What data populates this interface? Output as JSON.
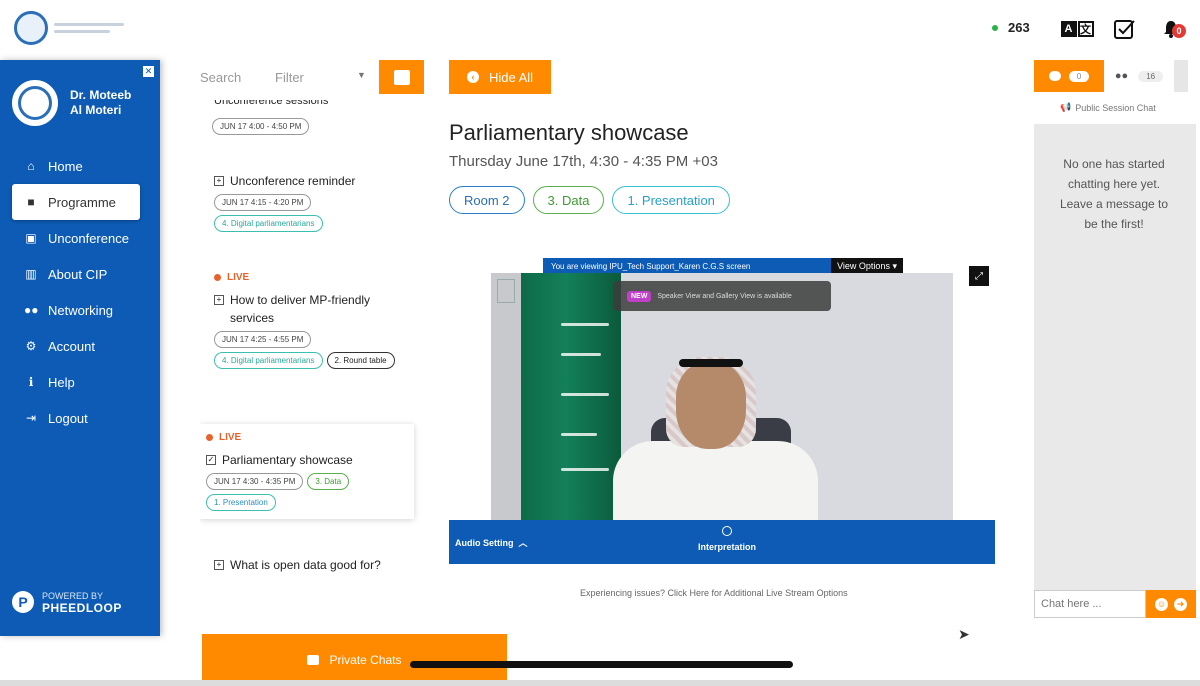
{
  "topbar": {
    "online_count": "263",
    "notification_count": "0"
  },
  "sidebar": {
    "profile_name": "Dr. Moteeb Al Moteri",
    "nav": [
      {
        "label": "Home",
        "icon": "home-icon"
      },
      {
        "label": "Programme",
        "icon": "video-icon",
        "active": true
      },
      {
        "label": "Unconference",
        "icon": "calendar-check-icon"
      },
      {
        "label": "About CIP",
        "icon": "building-icon"
      },
      {
        "label": "Networking",
        "icon": "people-icon"
      },
      {
        "label": "Account",
        "icon": "gear-icon"
      },
      {
        "label": "Help",
        "icon": "info-icon"
      },
      {
        "label": "Logout",
        "icon": "logout-icon"
      }
    ],
    "powered_by": "POWERED BY",
    "brand": "PHEEDLOOP"
  },
  "schedule": {
    "search_label": "Search",
    "filter_label": "Filter",
    "sessions": [
      {
        "title": "Unconference sessions",
        "time": "JUN 17 4:00 - 4:50 PM"
      },
      {
        "title": "Unconference reminder",
        "time": "JUN 17 4:15 - 4:20 PM",
        "tags": [
          "4. Digital parliamentarians"
        ]
      },
      {
        "live": "LIVE",
        "title": "How to deliver MP-friendly services",
        "time": "JUN 17 4:25 - 4:55 PM",
        "tags": [
          "4. Digital parliamentarians",
          "2. Round table"
        ]
      },
      {
        "live": "LIVE",
        "title": "Parliamentary showcase",
        "time": "JUN 17 4:30 - 4:35 PM",
        "tags": [
          "3. Data",
          "1. Presentation"
        ],
        "current": true
      },
      {
        "title": "What is open data good for?"
      }
    ],
    "private_chats_label": "Private Chats"
  },
  "main": {
    "hide_all_label": "Hide All",
    "title": "Parliamentary showcase",
    "datetime": "Thursday June 17th, 4:30 - 4:35 PM +03",
    "tags": [
      "Room 2",
      "3. Data",
      "1. Presentation"
    ],
    "viewing_text": "You are viewing IPU_Tech Support_Karen C.G.S screen",
    "view_options_label": "View Options",
    "new_badge": "NEW",
    "new_text": "Speaker View and Gallery View is available",
    "audio_setting_label": "Audio Setting",
    "interpretation_label": "Interpretation",
    "issues_text": "Experiencing issues? Click Here for Additional Live Stream Options"
  },
  "chat": {
    "chat_count": "0",
    "attendee_count": "16",
    "public_chat_label": "Public Session Chat",
    "empty_message": "No one has started chatting here yet. Leave a message to be the first!",
    "input_placeholder": "Chat here ..."
  },
  "colors": {
    "brand_blue": "#0d5bb5",
    "accent_orange": "#ff8a00",
    "live_red": "#e8632b"
  }
}
